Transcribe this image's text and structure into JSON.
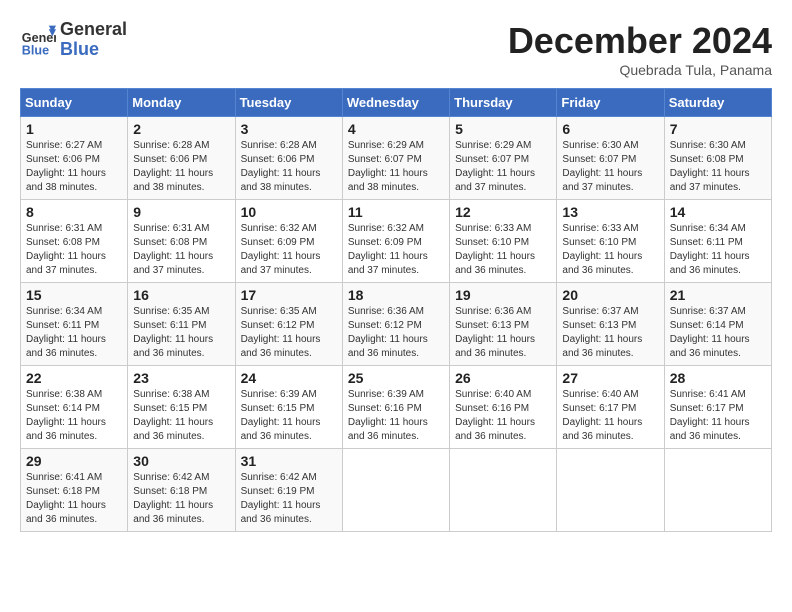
{
  "header": {
    "logo_line1": "General",
    "logo_line2": "Blue",
    "month_year": "December 2024",
    "location": "Quebrada Tula, Panama"
  },
  "days_of_week": [
    "Sunday",
    "Monday",
    "Tuesday",
    "Wednesday",
    "Thursday",
    "Friday",
    "Saturday"
  ],
  "weeks": [
    [
      {
        "day": "1",
        "sunrise": "6:27 AM",
        "sunset": "6:06 PM",
        "daylight": "11 hours and 38 minutes."
      },
      {
        "day": "2",
        "sunrise": "6:28 AM",
        "sunset": "6:06 PM",
        "daylight": "11 hours and 38 minutes."
      },
      {
        "day": "3",
        "sunrise": "6:28 AM",
        "sunset": "6:06 PM",
        "daylight": "11 hours and 38 minutes."
      },
      {
        "day": "4",
        "sunrise": "6:29 AM",
        "sunset": "6:07 PM",
        "daylight": "11 hours and 38 minutes."
      },
      {
        "day": "5",
        "sunrise": "6:29 AM",
        "sunset": "6:07 PM",
        "daylight": "11 hours and 37 minutes."
      },
      {
        "day": "6",
        "sunrise": "6:30 AM",
        "sunset": "6:07 PM",
        "daylight": "11 hours and 37 minutes."
      },
      {
        "day": "7",
        "sunrise": "6:30 AM",
        "sunset": "6:08 PM",
        "daylight": "11 hours and 37 minutes."
      }
    ],
    [
      {
        "day": "8",
        "sunrise": "6:31 AM",
        "sunset": "6:08 PM",
        "daylight": "11 hours and 37 minutes."
      },
      {
        "day": "9",
        "sunrise": "6:31 AM",
        "sunset": "6:08 PM",
        "daylight": "11 hours and 37 minutes."
      },
      {
        "day": "10",
        "sunrise": "6:32 AM",
        "sunset": "6:09 PM",
        "daylight": "11 hours and 37 minutes."
      },
      {
        "day": "11",
        "sunrise": "6:32 AM",
        "sunset": "6:09 PM",
        "daylight": "11 hours and 37 minutes."
      },
      {
        "day": "12",
        "sunrise": "6:33 AM",
        "sunset": "6:10 PM",
        "daylight": "11 hours and 36 minutes."
      },
      {
        "day": "13",
        "sunrise": "6:33 AM",
        "sunset": "6:10 PM",
        "daylight": "11 hours and 36 minutes."
      },
      {
        "day": "14",
        "sunrise": "6:34 AM",
        "sunset": "6:11 PM",
        "daylight": "11 hours and 36 minutes."
      }
    ],
    [
      {
        "day": "15",
        "sunrise": "6:34 AM",
        "sunset": "6:11 PM",
        "daylight": "11 hours and 36 minutes."
      },
      {
        "day": "16",
        "sunrise": "6:35 AM",
        "sunset": "6:11 PM",
        "daylight": "11 hours and 36 minutes."
      },
      {
        "day": "17",
        "sunrise": "6:35 AM",
        "sunset": "6:12 PM",
        "daylight": "11 hours and 36 minutes."
      },
      {
        "day": "18",
        "sunrise": "6:36 AM",
        "sunset": "6:12 PM",
        "daylight": "11 hours and 36 minutes."
      },
      {
        "day": "19",
        "sunrise": "6:36 AM",
        "sunset": "6:13 PM",
        "daylight": "11 hours and 36 minutes."
      },
      {
        "day": "20",
        "sunrise": "6:37 AM",
        "sunset": "6:13 PM",
        "daylight": "11 hours and 36 minutes."
      },
      {
        "day": "21",
        "sunrise": "6:37 AM",
        "sunset": "6:14 PM",
        "daylight": "11 hours and 36 minutes."
      }
    ],
    [
      {
        "day": "22",
        "sunrise": "6:38 AM",
        "sunset": "6:14 PM",
        "daylight": "11 hours and 36 minutes."
      },
      {
        "day": "23",
        "sunrise": "6:38 AM",
        "sunset": "6:15 PM",
        "daylight": "11 hours and 36 minutes."
      },
      {
        "day": "24",
        "sunrise": "6:39 AM",
        "sunset": "6:15 PM",
        "daylight": "11 hours and 36 minutes."
      },
      {
        "day": "25",
        "sunrise": "6:39 AM",
        "sunset": "6:16 PM",
        "daylight": "11 hours and 36 minutes."
      },
      {
        "day": "26",
        "sunrise": "6:40 AM",
        "sunset": "6:16 PM",
        "daylight": "11 hours and 36 minutes."
      },
      {
        "day": "27",
        "sunrise": "6:40 AM",
        "sunset": "6:17 PM",
        "daylight": "11 hours and 36 minutes."
      },
      {
        "day": "28",
        "sunrise": "6:41 AM",
        "sunset": "6:17 PM",
        "daylight": "11 hours and 36 minutes."
      }
    ],
    [
      {
        "day": "29",
        "sunrise": "6:41 AM",
        "sunset": "6:18 PM",
        "daylight": "11 hours and 36 minutes."
      },
      {
        "day": "30",
        "sunrise": "6:42 AM",
        "sunset": "6:18 PM",
        "daylight": "11 hours and 36 minutes."
      },
      {
        "day": "31",
        "sunrise": "6:42 AM",
        "sunset": "6:19 PM",
        "daylight": "11 hours and 36 minutes."
      },
      null,
      null,
      null,
      null
    ]
  ]
}
